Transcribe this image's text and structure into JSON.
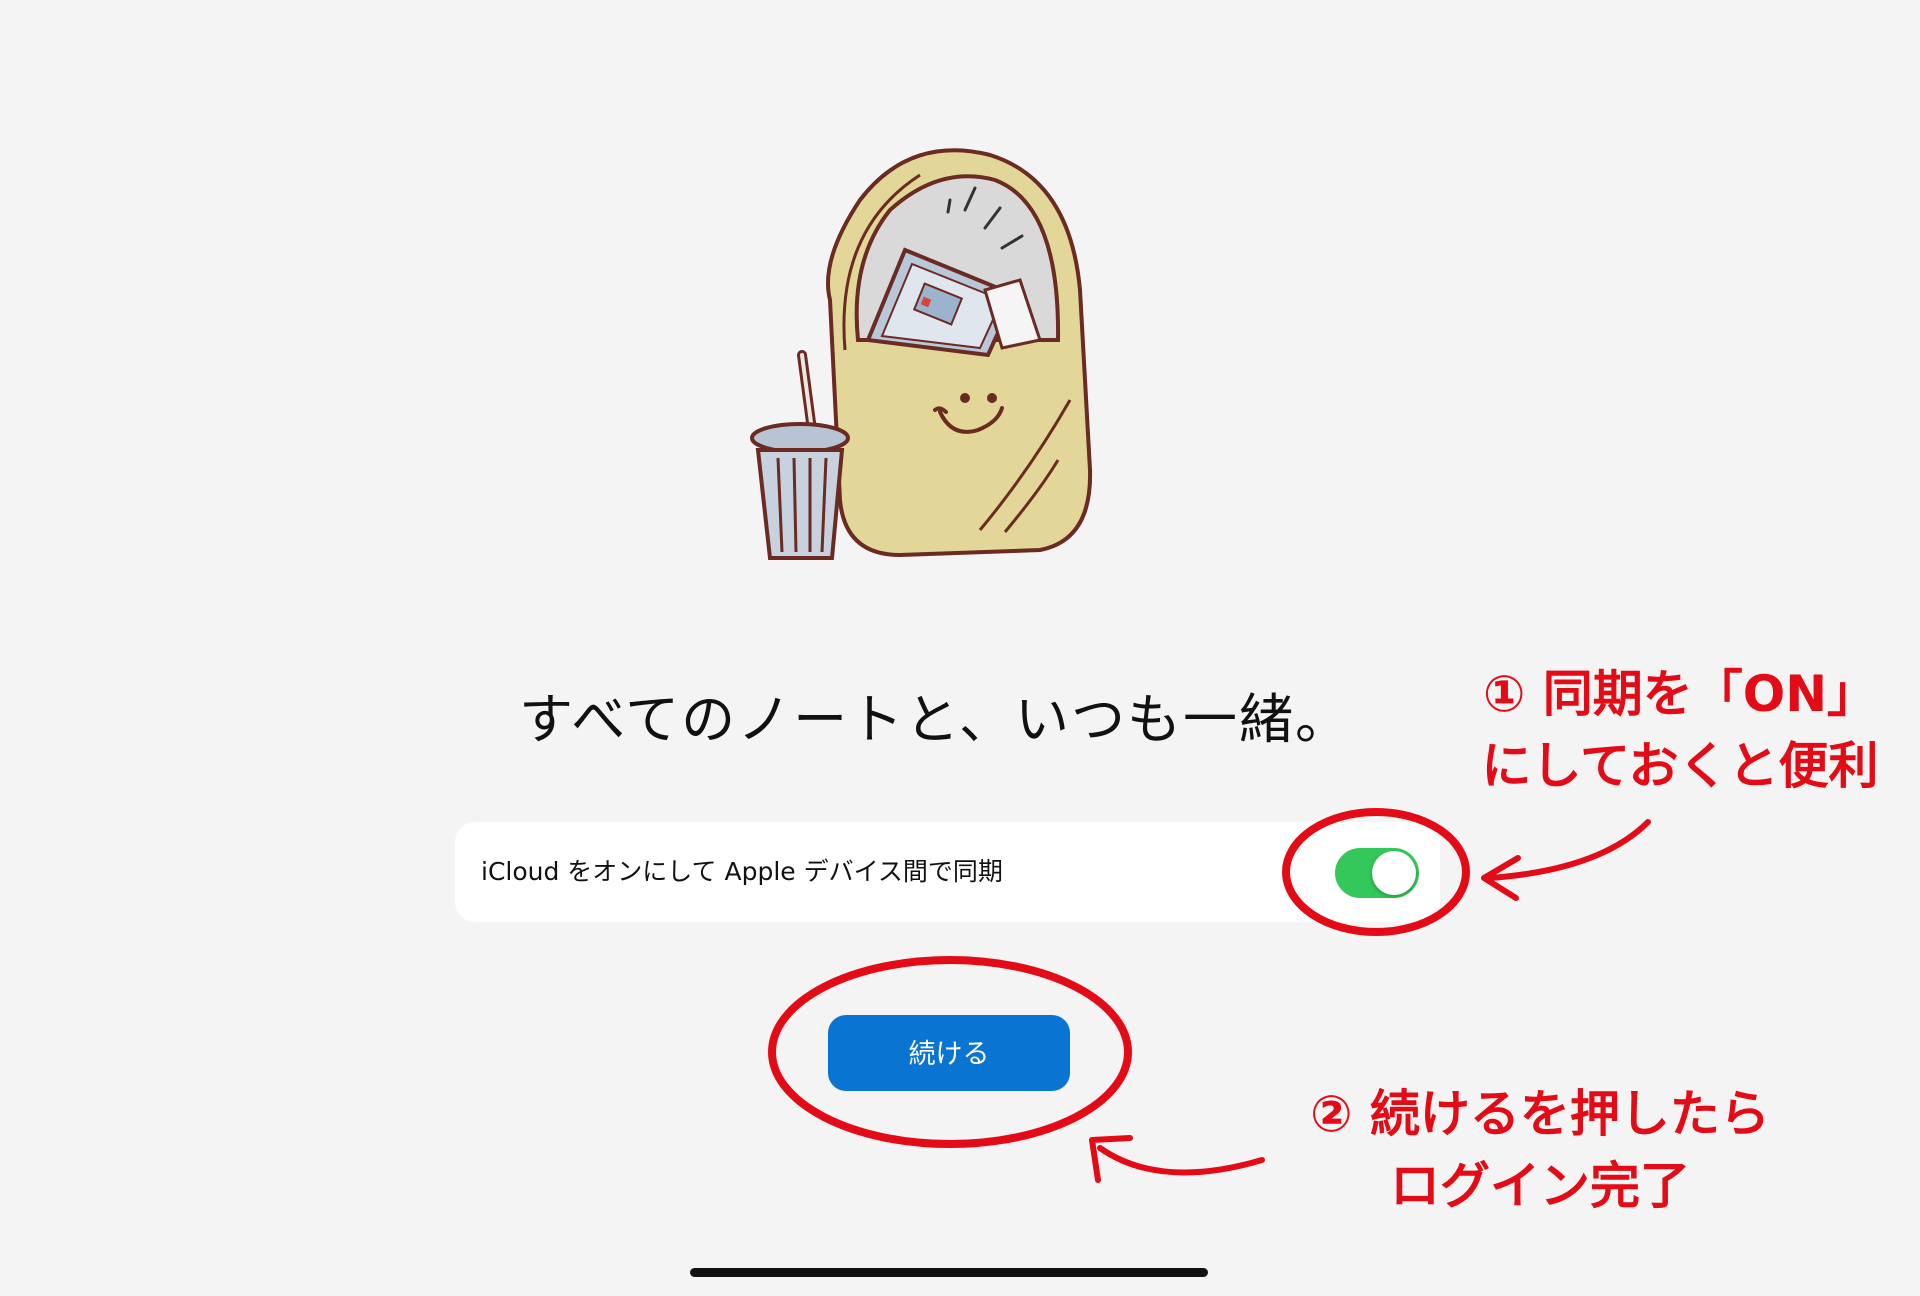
{
  "onboarding": {
    "headline": "すべてのノートと、いつも一緒。",
    "sync_label": "iCloud をオンにして Apple デバイス間で同期",
    "sync_enabled": true,
    "continue_label": "続ける"
  },
  "annotations": {
    "note1_line1": "① 同期を「ON」",
    "note1_line2": "にしておくと便利",
    "note2_line1": "② 続けるを押したら",
    "note2_line2": "ログイン完了",
    "color": "#e30b16"
  },
  "colors": {
    "background": "#f4f4f4",
    "toggle_on": "#34c759",
    "button_primary": "#0a74d2"
  },
  "icons": {
    "illustration": "tote-bag-with-drink-illustration"
  }
}
